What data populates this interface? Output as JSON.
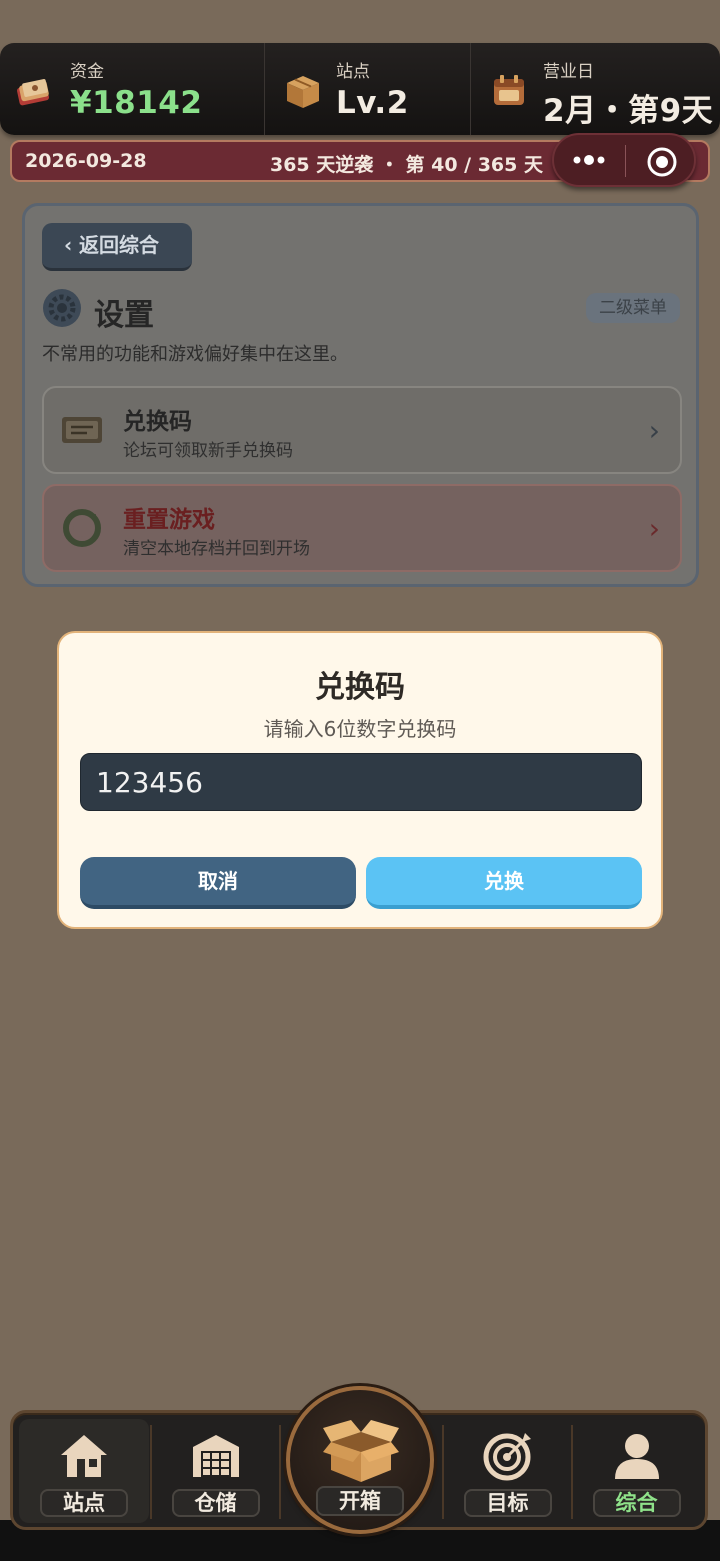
{
  "stats": {
    "funds": {
      "label": "资金",
      "value": "¥18142",
      "icon": "cash-stack-icon"
    },
    "station": {
      "label": "站点",
      "value": "Lv.2",
      "icon": "cardboard-box-icon"
    },
    "business_day": {
      "label": "营业日",
      "value": "2月・第9天",
      "icon": "calendar-box-icon"
    }
  },
  "banner": {
    "date": "2026-09-28",
    "progress": "365 天逆袭 ・ 第 40 / 365 天"
  },
  "capsule": {
    "more_icon": "more-dots-icon",
    "close_icon": "target-circle-icon"
  },
  "settings": {
    "back_label": "返回综合",
    "title": "设置",
    "badge": "二级菜单",
    "description": "不常用的功能和游戏偏好集中在这里。",
    "items": [
      {
        "title": "兑换码",
        "desc": "论坛可领取新手兑换码",
        "icon": "ticket-icon"
      },
      {
        "title": "重置游戏",
        "desc": "清空本地存档并回到开场",
        "icon": "reset-ring-icon"
      }
    ]
  },
  "modal": {
    "title": "兑换码",
    "hint": "请输入6位数字兑换码",
    "input_value": "123456",
    "cancel_label": "取消",
    "confirm_label": "兑换"
  },
  "nav": {
    "items": [
      {
        "label": "站点",
        "icon": "house-icon"
      },
      {
        "label": "仓储",
        "icon": "warehouse-icon"
      },
      {
        "label": "开箱",
        "icon": "open-box-icon"
      },
      {
        "label": "目标",
        "icon": "target-icon"
      },
      {
        "label": "综合",
        "icon": "user-icon"
      }
    ],
    "active_index": 4
  },
  "colors": {
    "background": "#796a5a",
    "funds_value": "#8be08b",
    "banner": "#6b2a33",
    "modal_bg": "#fff8ea",
    "cancel_button": "#416482",
    "confirm_button": "#5bc3f4",
    "active_nav_label": "#8fe28a",
    "reset_title": "#6a1f20"
  }
}
